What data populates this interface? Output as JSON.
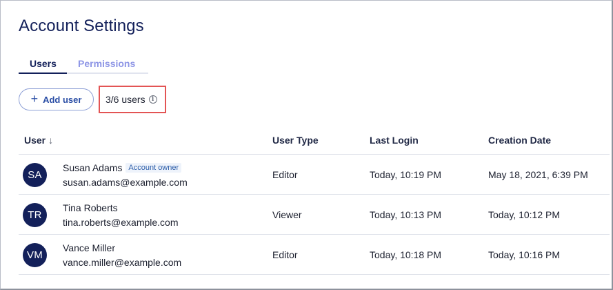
{
  "page": {
    "title": "Account Settings"
  },
  "tabs": [
    {
      "label": "Users",
      "active": true
    },
    {
      "label": "Permissions",
      "active": false
    }
  ],
  "toolbar": {
    "add_user_label": "Add user",
    "add_icon": "plus-icon",
    "user_count": "3/6 users",
    "info_icon": "info-icon"
  },
  "table": {
    "headers": {
      "user": "User",
      "user_sort_icon": "arrow-down-icon",
      "user_type": "User Type",
      "last_login": "Last Login",
      "creation_date": "Creation Date"
    },
    "rows": [
      {
        "initials": "SA",
        "name": "Susan Adams",
        "badge": "Account owner",
        "email": "susan.adams@example.com",
        "user_type": "Editor",
        "last_login": "Today, 10:19 PM",
        "creation_date": "May 18, 2021, 6:39 PM"
      },
      {
        "initials": "TR",
        "name": "Tina Roberts",
        "badge": "",
        "email": "tina.roberts@example.com",
        "user_type": "Viewer",
        "last_login": "Today, 10:13 PM",
        "creation_date": "Today, 10:12 PM"
      },
      {
        "initials": "VM",
        "name": "Vance Miller",
        "badge": "",
        "email": "vance.miller@example.com",
        "user_type": "Editor",
        "last_login": "Today, 10:18 PM",
        "creation_date": "Today, 10:16 PM"
      }
    ]
  },
  "colors": {
    "primary": "#13205a",
    "accent": "#2a4ea5",
    "inactive_tab": "#8e96e6",
    "highlight_border": "#e35454"
  }
}
